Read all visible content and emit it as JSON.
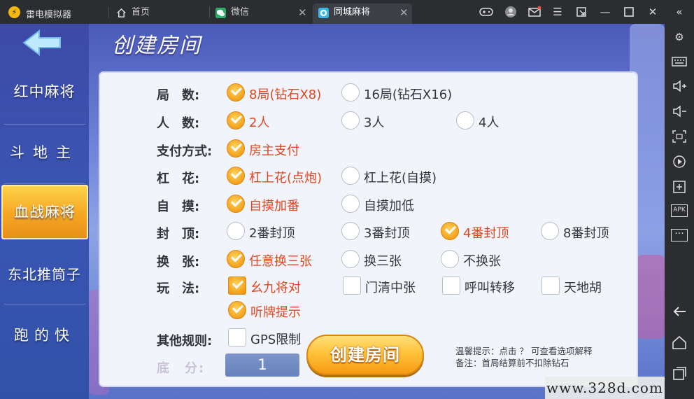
{
  "titlebar": {
    "app_name": "雷电模拟器",
    "tabs": [
      {
        "label": "首页",
        "icon": "home-icon"
      },
      {
        "label": "微信",
        "icon": "wechat-icon"
      },
      {
        "label": "同城麻将",
        "icon": "mahjong-app-icon"
      }
    ],
    "controls": [
      "gamepad-icon",
      "user-icon",
      "mail-icon",
      "menu-icon",
      "fullscreen-icon",
      "minimize-icon",
      "maximize-icon",
      "close-icon",
      "collapse-icon"
    ]
  },
  "sidebar": {
    "buttons": [
      "settings-icon",
      "keyboard-icon",
      "volume-up-icon",
      "volume-down-icon",
      "screenshot-icon",
      "record-icon",
      "add-app-icon",
      "apk-install-icon",
      "more-icon",
      "back-icon",
      "home-icon",
      "recent-apps-icon"
    ]
  },
  "game": {
    "page_title": "创建房间",
    "nav": [
      "红中麻将",
      "斗地主",
      "血战麻将",
      "东北推筒子",
      "跑的快"
    ],
    "active_nav_index": 2,
    "rows": {
      "rounds": {
        "label": "局　数:",
        "options": [
          "8局(钻石X8)",
          "16局(钻石X16)"
        ],
        "selected": 0
      },
      "players": {
        "label": "人　数:",
        "options": [
          "2人",
          "3人",
          "4人"
        ],
        "selected": 0
      },
      "payment": {
        "label": "支付方式:",
        "options": [
          "房主支付"
        ],
        "selected": 0
      },
      "gang": {
        "label": "杠　花:",
        "options": [
          "杠上花(点炮)",
          "杠上花(自摸)"
        ],
        "selected": 0
      },
      "zimo": {
        "label": "自　摸:",
        "options": [
          "自摸加番",
          "自摸加低"
        ],
        "selected": 0
      },
      "cap": {
        "label": "封　顶:",
        "options": [
          "2番封顶",
          "3番封顶",
          "4番封顶",
          "8番封顶"
        ],
        "selected": 2
      },
      "swap": {
        "label": "换　张:",
        "options": [
          "任意换三张",
          "换三张",
          "不换张"
        ],
        "selected": 0
      },
      "play": {
        "label": "玩　法:",
        "options": [
          "幺九将对",
          "门清中张",
          "呼叫转移",
          "天地胡"
        ],
        "checked": [
          true,
          false,
          false,
          false
        ]
      },
      "hint": {
        "options": [
          "听牌提示"
        ],
        "checked": [
          true
        ]
      },
      "other": {
        "label": "其他规则:",
        "options": [
          "GPS限制"
        ],
        "checked": [
          false
        ]
      }
    },
    "base_label": "底　分:",
    "base_value": "1",
    "create_button": "创建房间",
    "tip_line1": "温馨提示：点击 ？ 可查看选项解释",
    "tip_line2": "备注：首局结算前不扣除钻石",
    "watermark": "www.328d.com"
  },
  "colors": {
    "accent": "#f4a01d",
    "selected_text": "#e2461f",
    "panel_bg": "#f1f4fb"
  }
}
